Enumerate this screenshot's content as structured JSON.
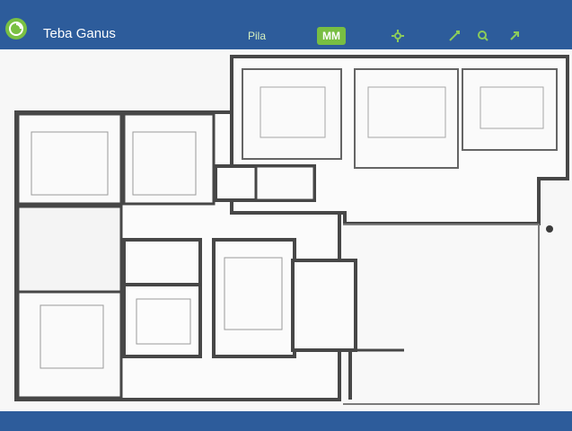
{
  "app": {
    "title": "Teba Ganus"
  },
  "toolbar": {
    "items": [
      {
        "label": "Pila"
      },
      {
        "label": "MM"
      }
    ],
    "icons": [
      "gear-icon",
      "pen-icon",
      "zoom-icon",
      "share-icon"
    ]
  },
  "colors": {
    "header": "#2d5c9b",
    "accent": "#78be43",
    "plan_wall": "#474747"
  },
  "status": {
    "text": ""
  }
}
